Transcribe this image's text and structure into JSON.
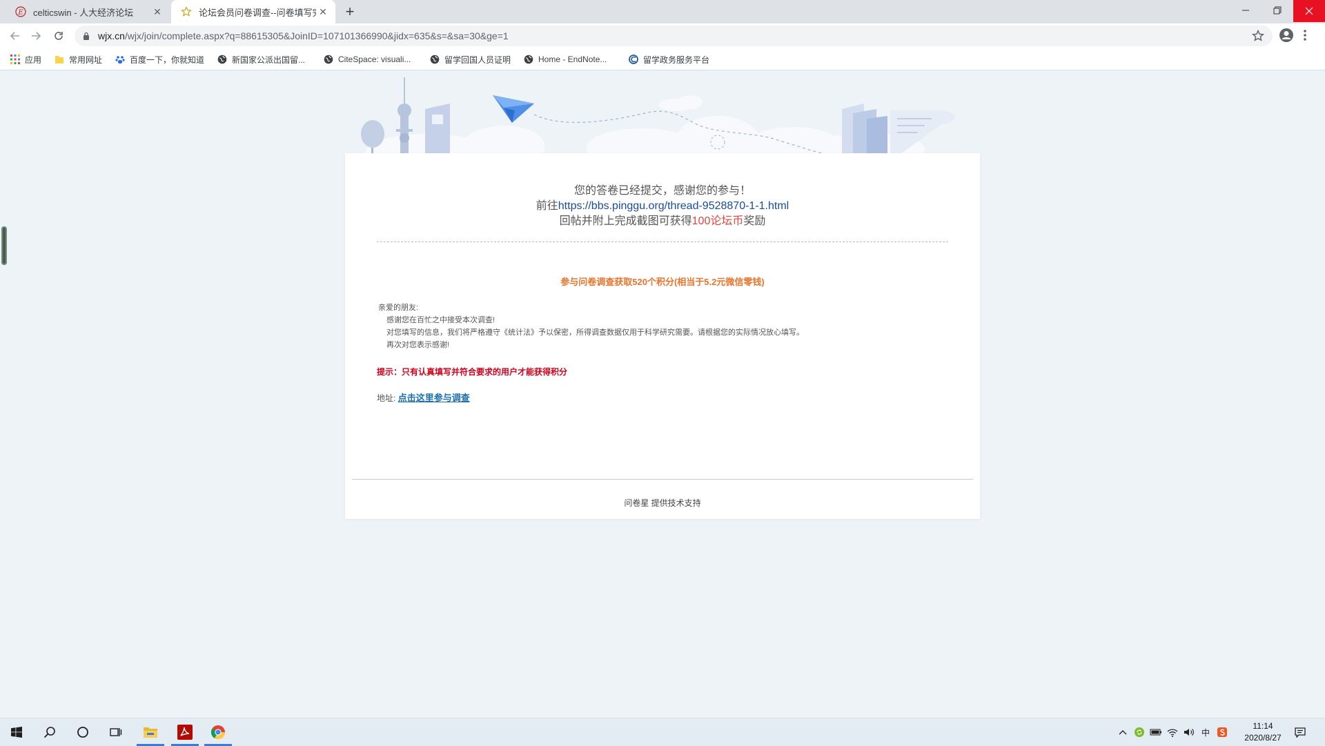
{
  "browser": {
    "tabs": [
      {
        "title": "celticswin - 人大经济论坛",
        "icon": "site-e-icon"
      },
      {
        "title": "论坛会员问卷调查--问卷填写完成",
        "icon": "star-outline-icon"
      }
    ],
    "new_tab_label": "+",
    "url": {
      "host": "wjx.cn",
      "path": "/wjx/join/complete.aspx?q=88615305&JoinID=107101366990&jidx=635&s=&sa=30&ge=1"
    },
    "bookmarks": [
      {
        "label": "应用",
        "icon": "apps-grid-icon"
      },
      {
        "label": "常用网址",
        "icon": "folder-icon"
      },
      {
        "label": "百度一下，你就知道",
        "icon": "baidu-paw-icon"
      },
      {
        "label": "新国家公派出国留...",
        "icon": "globe-icon"
      },
      {
        "label": "CiteSpace: visuali...",
        "icon": "globe-icon"
      },
      {
        "label": "留学回国人员证明",
        "icon": "globe-icon"
      },
      {
        "label": "Home - EndNote...",
        "icon": "globe-icon"
      },
      {
        "label": "留学政务服务平台",
        "icon": "cscse-icon"
      }
    ]
  },
  "page": {
    "thanks_line": "您的答卷已经提交，感谢您的参与！",
    "go_prefix": "前往",
    "forum_link": "https://bbs.pinggu.org/thread-9528870-1-1.html",
    "reward_before": "回帖并附上完成截图可获得",
    "reward_amount": "100论坛币",
    "reward_after": "奖励",
    "promo_title": "参与问卷调查获取520个积分(相当于5.2元微信零钱)",
    "letter": {
      "greeting": "亲爱的朋友:",
      "line1": "感谢您在百忙之中接受本次调查!",
      "line2": "对您填写的信息，我们将严格遵守《统计法》予以保密，所得调查数据仅用于科学研究需要。请根据您的实际情况放心填写。",
      "line3": "再次对您表示感谢!"
    },
    "tip": "提示：只有认真填写并符合要求的用户才能获得积分",
    "address_label": "地址:",
    "address_link": "点击这里参与调查",
    "footer": "问卷星 提供技术支持"
  },
  "taskbar": {
    "apps": [
      "windows-start-icon",
      "search-icon",
      "cortana-icon",
      "task-view-icon",
      "file-explorer-icon",
      "acrobat-icon",
      "chrome-icon"
    ],
    "tray_ime": "中",
    "time": "11:14",
    "date": "2020/8/27"
  },
  "colors": {
    "page_bg": "#eef3f8",
    "link_blue": "#1a4b9c",
    "promo_orange": "#e8752c",
    "tip_red": "#d0021b",
    "reward_red": "#e0463f",
    "close_red": "#e81123"
  }
}
